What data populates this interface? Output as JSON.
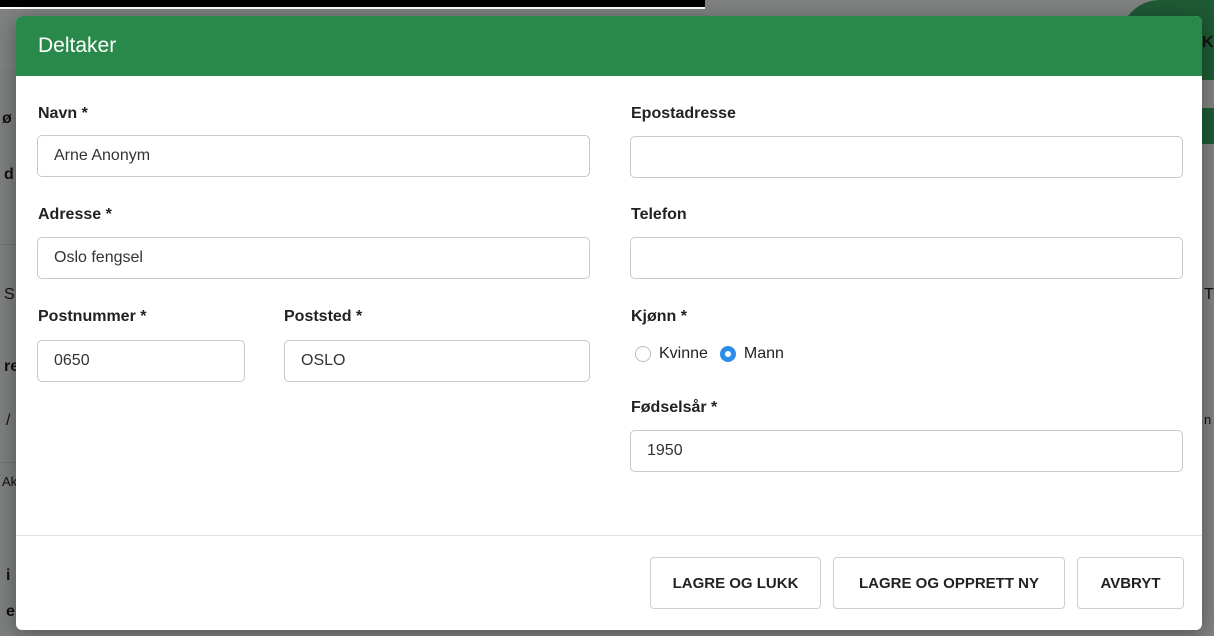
{
  "background": {
    "corner_letter": "K",
    "side_letters": [
      "ø",
      "d",
      "S",
      "re",
      "/",
      "Ak",
      "i",
      "e"
    ],
    "right_letters": [
      "T",
      "n"
    ]
  },
  "dialog": {
    "title": "Deltaker",
    "fields": {
      "navn": {
        "label": "Navn *",
        "value": "Arne Anonym"
      },
      "adresse": {
        "label": "Adresse *",
        "value": "Oslo fengsel"
      },
      "postnummer": {
        "label": "Postnummer *",
        "value": "0650"
      },
      "poststed": {
        "label": "Poststed *",
        "value": "OSLO"
      },
      "epost": {
        "label": "Epostadresse",
        "value": ""
      },
      "telefon": {
        "label": "Telefon",
        "value": ""
      },
      "kjonn": {
        "label": "Kjønn *",
        "options": [
          "Kvinne",
          "Mann"
        ],
        "selected": "Mann"
      },
      "fodselsar": {
        "label": "Fødselsår *",
        "value": "1950"
      }
    },
    "buttons": {
      "save_close": "LAGRE OG LUKK",
      "save_new": "LAGRE OG OPPRETT NY",
      "cancel": "AVBRYT"
    }
  },
  "colors": {
    "header": "#28894a",
    "radio_selected": "#2b8de6",
    "backdrop": "#7f8280"
  }
}
